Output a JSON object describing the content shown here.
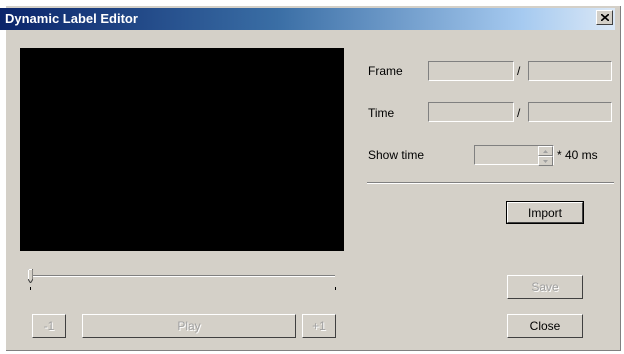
{
  "window": {
    "title": "Dynamic Label Editor"
  },
  "fields": {
    "frame_label": "Frame",
    "time_label": "Time",
    "separator": "/",
    "show_time_label": "Show time",
    "show_time_unit": "* 40 ms",
    "frame_current": "",
    "frame_total": "",
    "time_current": "",
    "time_total": "",
    "show_time_value": ""
  },
  "buttons": {
    "import": "Import",
    "save": "Save",
    "close": "Close",
    "prev": "-1",
    "play": "Play",
    "next": "+1"
  },
  "slider": {
    "position": 0
  },
  "icons": {
    "close": "close-icon",
    "spin_up": "spin-up-icon",
    "spin_down": "spin-down-icon"
  }
}
